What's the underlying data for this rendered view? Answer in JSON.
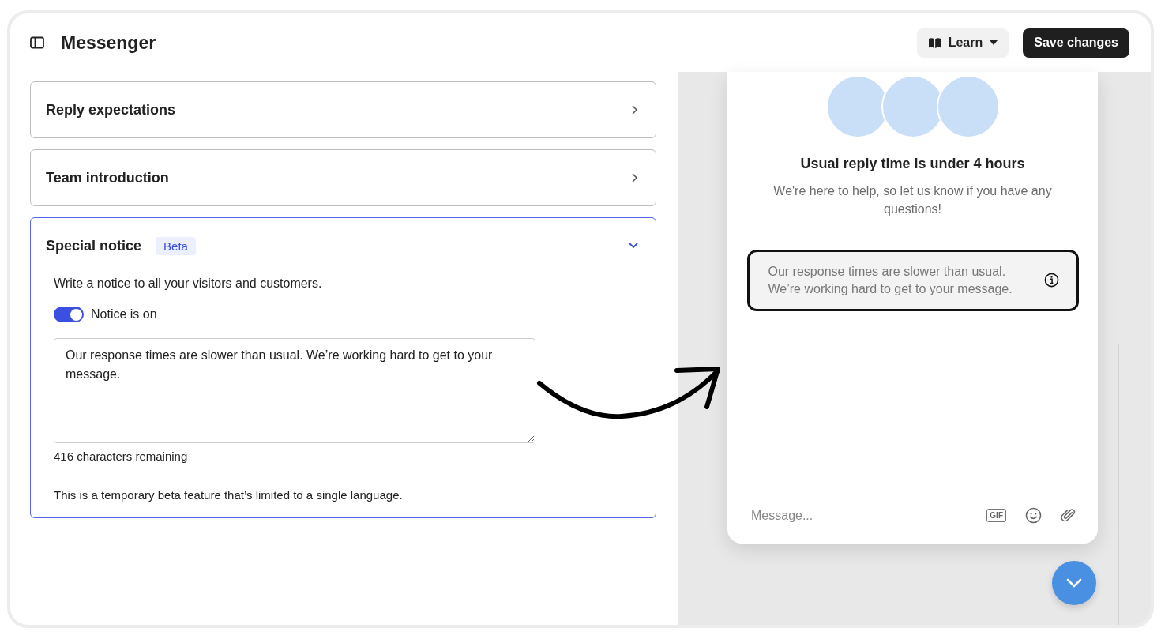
{
  "header": {
    "title": "Messenger",
    "learn_button": "Learn",
    "save_button": "Save changes"
  },
  "sections": [
    {
      "title": "Reply expectations",
      "expanded": false
    },
    {
      "title": "Team introduction",
      "expanded": false
    },
    {
      "title": "Special notice",
      "badge": "Beta",
      "expanded": true,
      "description": "Write a notice to all your visitors and customers.",
      "toggle": {
        "label": "Notice is on",
        "on": true
      },
      "notice_text": "Our response times are slower than usual. We’re working hard to get to your message.",
      "remaining": "416 characters remaining",
      "footnote": "This is a temporary beta feature that’s limited to a single language."
    }
  ],
  "preview": {
    "heading": "Usual reply time is under 4 hours",
    "subtext": "We're here to help, so let us know if you have any questions!",
    "notice": "Our response times are slower than usual. We’re working hard to get to your message.",
    "message_placeholder": "Message...",
    "gif_label": "GIF"
  }
}
